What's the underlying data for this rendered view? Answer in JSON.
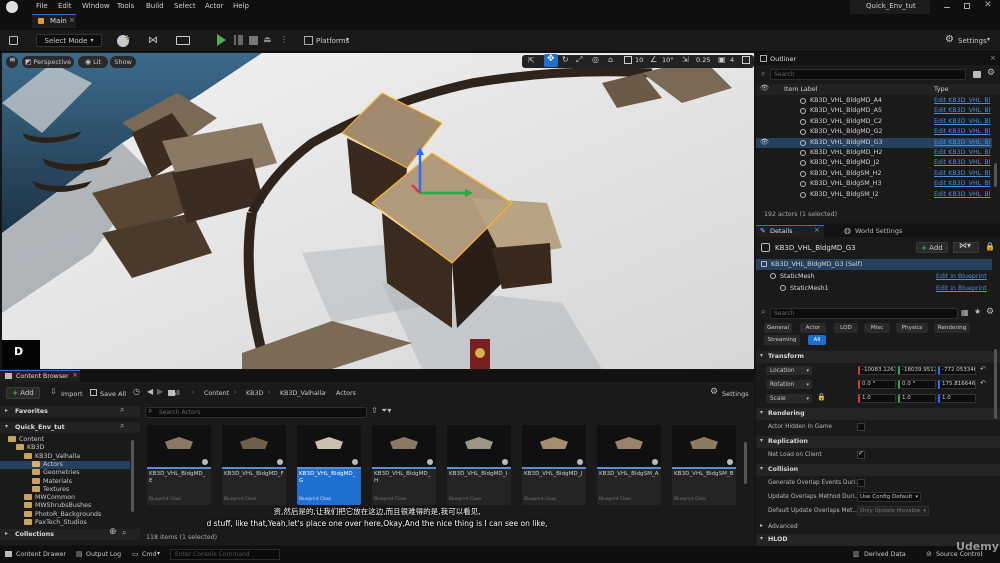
{
  "menubar": {
    "items": [
      "File",
      "Edit",
      "Window",
      "Tools",
      "Build",
      "Select",
      "Actor",
      "Help"
    ],
    "project_name": "Quick_Env_tut"
  },
  "tabs": {
    "level_tab": "Main"
  },
  "toolbar": {
    "select_mode": "Select Mode",
    "platforms": "Platforms",
    "settings": "Settings"
  },
  "viewport": {
    "perspective": "Perspective",
    "lit": "Lit",
    "show": "Show",
    "grid_snap": "10",
    "rot_snap": "10°",
    "scale_snap": "0.25",
    "cam_speed": "4",
    "mini_badge": "D"
  },
  "outliner": {
    "tab": "Outliner",
    "search_placeholder": "Search",
    "col_label": "Item Label",
    "col_type": "Type",
    "rows": [
      {
        "label": "KB3D_VHL_BldgMD_A4",
        "type": "Edit KB3D_VHL_Bl"
      },
      {
        "label": "KB3D_VHL_BldgMD_A5",
        "type": "Edit KB3D_VHL_Bl"
      },
      {
        "label": "KB3D_VHL_BldgMD_C2",
        "type": "Edit KB3D_VHL_Bl"
      },
      {
        "label": "KB3D_VHL_BldgMD_G2",
        "type": "Edit KB3D_VHL_Bl"
      },
      {
        "label": "KB3D_VHL_BldgMD_G3",
        "type": "Edit KB3D_VHL_Bl"
      },
      {
        "label": "KB3D_VHL_BldgMD_H2",
        "type": "Edit KB3D_VHL_Bl"
      },
      {
        "label": "KB3D_VHL_BldgMD_J2",
        "type": "Edit KB3D_VHL_Bl"
      },
      {
        "label": "KB3D_VHL_BldgSM_H2",
        "type": "Edit KB3D_VHL_Bl"
      },
      {
        "label": "KB3D_VHL_BldgSM_H3",
        "type": "Edit KB3D_VHL_Bl"
      },
      {
        "label": "KB3D_VHL_BldgSM_I2",
        "type": "Edit KB3D_VHL_Bl"
      }
    ],
    "status": "192 actors (1 selected)"
  },
  "details": {
    "tab_details": "Details",
    "tab_world": "World Settings",
    "actor_name": "KB3D_VHL_BldgMD_G3",
    "add": "Add",
    "components": [
      {
        "label": "KB3D_VHL_BldgMD_G3 (Self)",
        "action": ""
      },
      {
        "label": "StaticMesh",
        "action": "Edit in Blueprint"
      },
      {
        "label": "StaticMesh1",
        "action": "Edit in Blueprint"
      }
    ],
    "search_placeholder": "Search",
    "filters": [
      "General",
      "Actor",
      "LOD",
      "Misc",
      "Physics",
      "Rendering",
      "Streaming",
      "All"
    ],
    "transform": {
      "header": "Transform",
      "location_label": "Location",
      "rotation_label": "Rotation",
      "scale_label": "Scale",
      "location": [
        "-10083.1263",
        "-18039.9512",
        "-772.053346"
      ],
      "rotation": [
        "0.0 °",
        "0.0 °",
        "175.816646"
      ],
      "scale": [
        "1.0",
        "1.0",
        "1.0"
      ]
    },
    "rendering_header": "Rendering",
    "actor_hidden": "Actor Hidden In Game",
    "replication_header": "Replication",
    "net_load": "Net Load on Client",
    "collision_header": "Collision",
    "gen_overlap": "Generate Overlap Events Duri...",
    "update_overlap": "Update Overlaps Method Duri...",
    "update_overlap_value": "Use Config Default",
    "default_overlap": "Default Update Overlaps Met...",
    "default_overlap_value": "Only Update Movable",
    "advanced": "Advanced",
    "hlod_header": "HLOD"
  },
  "content_browser": {
    "tab": "Content Browser",
    "add": "Add",
    "import": "Import",
    "save_all": "Save All",
    "breadcrumb": [
      "All",
      "Content",
      "KB3D",
      "KB3D_Valhalla",
      "Actors"
    ],
    "settings": "Settings",
    "favorites": "Favorites",
    "project_root": "Quick_Env_tut",
    "tree": [
      "Content",
      "KB3D",
      "KB3D_Valhalla",
      "Actors",
      "Geometries",
      "Materials",
      "Textures",
      "MWCommon",
      "MWShrubsBushes",
      "PhotoR_Backgrounds",
      "PaxTech_Studios"
    ],
    "search_placeholder": "Search Actors",
    "assets": [
      {
        "name": "KB3D_VHL_BldgMD_E",
        "class": "Blueprint Class"
      },
      {
        "name": "KB3D_VHL_BldgMD_F",
        "class": "Blueprint Class"
      },
      {
        "name": "KB3D_VHL_BldgMD_G",
        "class": "Blueprint Class"
      },
      {
        "name": "KB3D_VHL_BldgMD_H",
        "class": "Blueprint Class"
      },
      {
        "name": "KB3D_VHL_BldgMD_I",
        "class": "Blueprint Class"
      },
      {
        "name": "KB3D_VHL_BldgMD_J",
        "class": "Blueprint Class"
      },
      {
        "name": "KB3D_VHL_BldgSM_A",
        "class": "Blueprint Class"
      },
      {
        "name": "KB3D_VHL_BldgSM_B",
        "class": "Blueprint Class"
      }
    ],
    "item_count": "118 items (1 selected)",
    "collections": "Collections"
  },
  "subtitles": {
    "zh": "资,然后是的,让我们把它放在这边,而且很难得的是,我可以看见,",
    "en": "d stuff, like that,Yeah,let's place one over here,Okay,And the nice thing is I can see on like,"
  },
  "statusbar": {
    "content_drawer": "Content Drawer",
    "output_log": "Output Log",
    "cmd": "Cmd",
    "console_placeholder": "Enter Console Command",
    "derived_data": "Derived Data",
    "source_control": "Source Control",
    "watermark": "Udemy"
  },
  "colors": {
    "selection": "#26405f",
    "accent_blue": "#1f6fd1",
    "link_blue": "#4a8fe0",
    "play_green": "#4caf50"
  }
}
